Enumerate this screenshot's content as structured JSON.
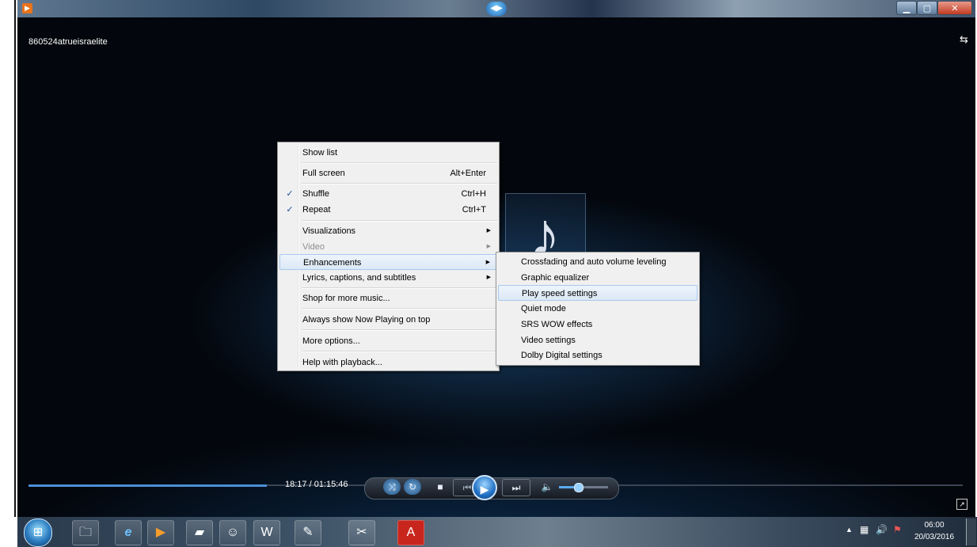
{
  "player": {
    "media_title": "860524atrueisraelite",
    "time": "18:17 / 01:15:46",
    "seek_fraction": 0.255,
    "volume_fraction": 0.38
  },
  "context_menu": {
    "items": [
      {
        "label": "Show list",
        "shortcut": "",
        "checked": false,
        "submenu": false,
        "disabled": false
      },
      {
        "label": "Full screen",
        "shortcut": "Alt+Enter",
        "checked": false,
        "submenu": false,
        "disabled": false
      },
      {
        "label": "Shuffle",
        "shortcut": "Ctrl+H",
        "checked": true,
        "submenu": false,
        "disabled": false
      },
      {
        "label": "Repeat",
        "shortcut": "Ctrl+T",
        "checked": true,
        "submenu": false,
        "disabled": false
      },
      {
        "label": "Visualizations",
        "shortcut": "",
        "checked": false,
        "submenu": true,
        "disabled": false
      },
      {
        "label": "Video",
        "shortcut": "",
        "checked": false,
        "submenu": true,
        "disabled": true
      },
      {
        "label": "Enhancements",
        "shortcut": "",
        "checked": false,
        "submenu": true,
        "disabled": false,
        "highlighted": true
      },
      {
        "label": "Lyrics, captions, and subtitles",
        "shortcut": "",
        "checked": false,
        "submenu": true,
        "disabled": false
      },
      {
        "label": "Shop for more music...",
        "shortcut": "",
        "checked": false,
        "submenu": false,
        "disabled": false
      },
      {
        "label": "Always show Now Playing on top",
        "shortcut": "",
        "checked": false,
        "submenu": false,
        "disabled": false
      },
      {
        "label": "More options...",
        "shortcut": "",
        "checked": false,
        "submenu": false,
        "disabled": false
      },
      {
        "label": "Help with playback...",
        "shortcut": "",
        "checked": false,
        "submenu": false,
        "disabled": false
      }
    ],
    "check_mark": "✓",
    "submenu_arrow": "▶"
  },
  "enhancements_menu": {
    "items": [
      {
        "label": "Crossfading and auto volume leveling",
        "highlighted": false
      },
      {
        "label": "Graphic equalizer",
        "highlighted": false
      },
      {
        "label": "Play speed settings",
        "highlighted": true
      },
      {
        "label": "Quiet mode",
        "highlighted": false
      },
      {
        "label": "SRS WOW effects",
        "highlighted": false
      },
      {
        "label": "Video settings",
        "highlighted": false
      },
      {
        "label": "Dolby Digital settings",
        "highlighted": false
      }
    ]
  },
  "taskbar": {
    "clock_time": "06:00",
    "clock_date": "20/03/2016",
    "pinned_icons": [
      "explorer-icon",
      "internet-explorer-icon",
      "media-player-icon",
      "folder-icon",
      "people-icon",
      "word-icon",
      "paint-icon",
      "snipping-tool-icon",
      "acrobat-icon"
    ]
  },
  "colors": {
    "highlight_border": "#a8c9ee",
    "seek_fill": "#4a8fd6",
    "check": "#1b4f9c"
  }
}
